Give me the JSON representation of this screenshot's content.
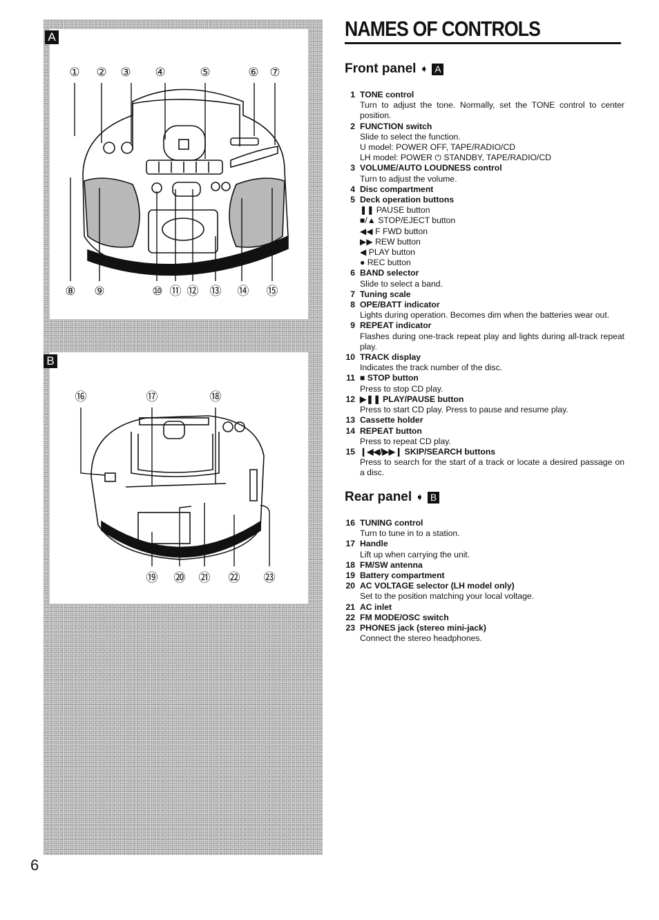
{
  "page": {
    "title": "NAMES OF CONTROLS",
    "page_number": "6"
  },
  "figures": {
    "panel_a": {
      "badge": "A",
      "callouts": [
        "①",
        "②",
        "③",
        "④",
        "⑤",
        "⑥",
        "⑦",
        "⑧",
        "⑨",
        "⑩",
        "⑪",
        "⑫",
        "⑬",
        "⑭",
        "⑮"
      ]
    },
    "panel_b": {
      "badge": "B",
      "callouts": [
        "⑯",
        "⑰",
        "⑱",
        "⑲",
        "⑳",
        "㉑",
        "㉒",
        "㉓"
      ]
    }
  },
  "front": {
    "heading": "Front panel",
    "arrow_icon": "➧",
    "badge": "A",
    "items": [
      {
        "num": "1",
        "label": "TONE control",
        "desc": [
          "Turn to adjust the tone. Normally, set the TONE control to center position."
        ]
      },
      {
        "num": "2",
        "label": "FUNCTION switch",
        "desc": [
          "Slide to select the function.",
          "U model: POWER OFF, TAPE/RADIO/CD",
          "LH model: POWER ⏻ STANDBY, TAPE/RADIO/CD"
        ]
      },
      {
        "num": "3",
        "label": "VOLUME/AUTO LOUDNESS control",
        "desc": [
          "Turn to adjust the volume."
        ]
      },
      {
        "num": "4",
        "label": "Disc compartment",
        "desc": []
      },
      {
        "num": "5",
        "label": "Deck operation buttons",
        "desc": [
          "❚❚ PAUSE button",
          "■/▲ STOP/EJECT button",
          "◀◀ F FWD button",
          "▶▶ REW button",
          "◀ PLAY button",
          "● REC button"
        ]
      },
      {
        "num": "6",
        "label": "BAND selector",
        "desc": [
          "Slide to select a band."
        ]
      },
      {
        "num": "7",
        "label": "Tuning scale",
        "desc": []
      },
      {
        "num": "8",
        "label": "OPE/BATT indicator",
        "desc": [
          "Lights during operation. Becomes dim when the batteries wear out."
        ]
      },
      {
        "num": "9",
        "label": "REPEAT indicator",
        "desc": [
          "Flashes during one-track repeat play and lights during all-track repeat play."
        ]
      },
      {
        "num": "10",
        "label": "TRACK display",
        "desc": [
          "Indicates the track number of the disc."
        ]
      },
      {
        "num": "11",
        "label": "■ STOP button",
        "desc": [
          "Press to stop CD play."
        ]
      },
      {
        "num": "12",
        "label": "▶❚❚ PLAY/PAUSE button",
        "desc": [
          "Press to start CD play. Press to pause and resume play."
        ]
      },
      {
        "num": "13",
        "label": "Cassette holder",
        "desc": []
      },
      {
        "num": "14",
        "label": "REPEAT button",
        "desc": [
          "Press to repeat CD play."
        ]
      },
      {
        "num": "15",
        "label": "❙◀◀/▶▶❙ SKIP/SEARCH buttons",
        "desc": [
          "Press to search for the start of a track or locate a desired passage on a disc."
        ]
      }
    ]
  },
  "rear": {
    "heading": "Rear panel",
    "arrow_icon": "➧",
    "badge": "B",
    "items": [
      {
        "num": "16",
        "label": "TUNING control",
        "desc": [
          "Turn to tune in to a station."
        ]
      },
      {
        "num": "17",
        "label": "Handle",
        "desc": [
          "Lift up when carrying the unit."
        ]
      },
      {
        "num": "18",
        "label": "FM/SW antenna",
        "desc": []
      },
      {
        "num": "19",
        "label": "Battery compartment",
        "desc": []
      },
      {
        "num": "20",
        "label": "AC VOLTAGE selector (LH model only)",
        "desc": [
          "Set to the position matching your local voltage."
        ]
      },
      {
        "num": "21",
        "label": "AC inlet",
        "desc": []
      },
      {
        "num": "22",
        "label": "FM MODE/OSC switch",
        "desc": []
      },
      {
        "num": "23",
        "label": "PHONES jack (stereo mini-jack)",
        "desc": [
          "Connect the stereo headphones."
        ]
      }
    ]
  }
}
